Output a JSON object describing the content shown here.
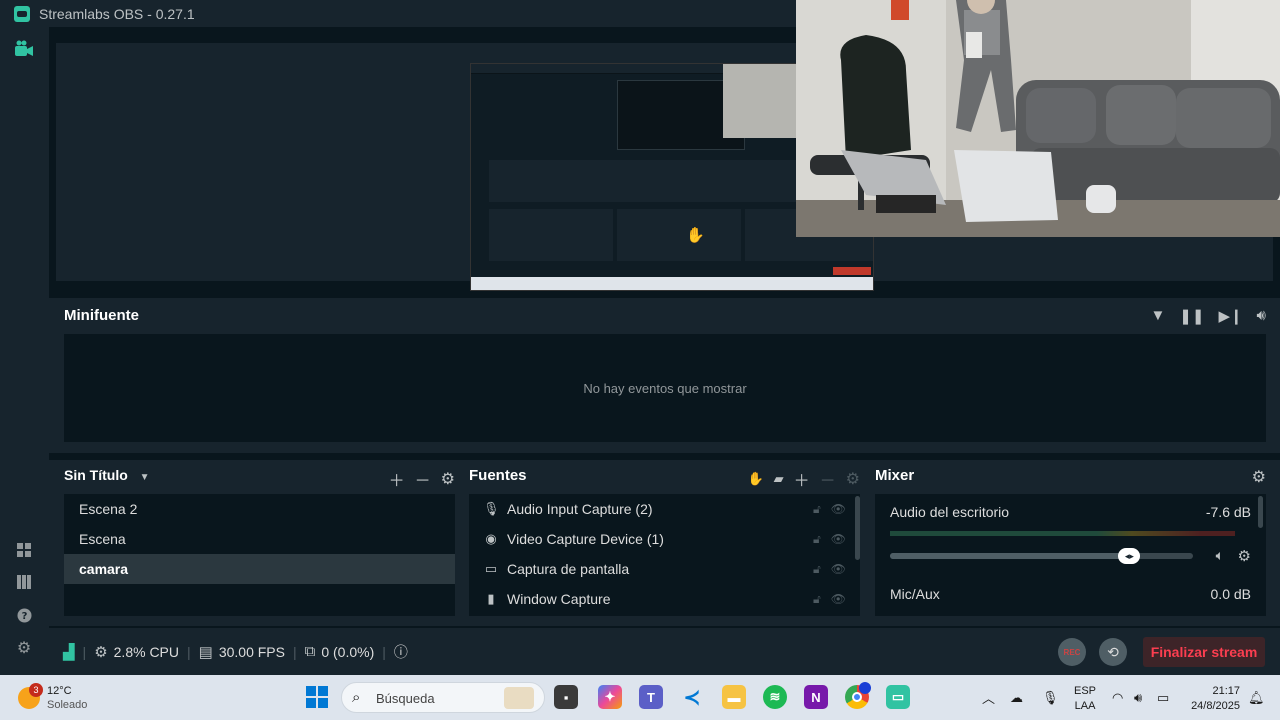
{
  "window": {
    "title": "Streamlabs OBS - 0.27.1"
  },
  "nav": {
    "studio": "video-camera-icon",
    "bottom": [
      "layout-icon",
      "columns-icon",
      "help-icon",
      "gear-icon"
    ]
  },
  "minifeed": {
    "title": "Minifuente",
    "empty_text": "No hay eventos que mostrar"
  },
  "scenes": {
    "collection": "Sin Título",
    "items": [
      "Escena 2",
      "Escena",
      "camara"
    ],
    "active_index": 2
  },
  "sources": {
    "title": "Fuentes",
    "items": [
      {
        "label": "Audio Input Capture (2)",
        "icon": "microphone-icon"
      },
      {
        "label": "Video Capture Device (1)",
        "icon": "webcam-icon"
      },
      {
        "label": "Captura de pantalla",
        "icon": "monitor-icon"
      },
      {
        "label": "Window Capture",
        "icon": "file-icon"
      }
    ]
  },
  "mixer": {
    "title": "Mixer",
    "tracks": [
      {
        "name": "Audio del escritorio",
        "db": "-7.6 dB",
        "volume": 0.79
      },
      {
        "name": "Mic/Aux",
        "db": "0.0 dB"
      }
    ]
  },
  "footer": {
    "cpu": "2.8% CPU",
    "fps": "30.00 FPS",
    "dropped": "0 (0.0%)",
    "rec_label": "REC",
    "end_stream": "Finalizar stream"
  },
  "taskbar": {
    "weather_temp": "12°C",
    "weather_desc": "Soleado",
    "weather_badge": "3",
    "search_placeholder": "Búsqueda",
    "lang_1": "ESP",
    "lang_2": "LAA",
    "time": "21:17",
    "date": "24/8/2025"
  },
  "colors": {
    "accent": "#31c3a2",
    "danger": "#fc3e50",
    "panel": "#17242d",
    "well": "#09161d"
  }
}
